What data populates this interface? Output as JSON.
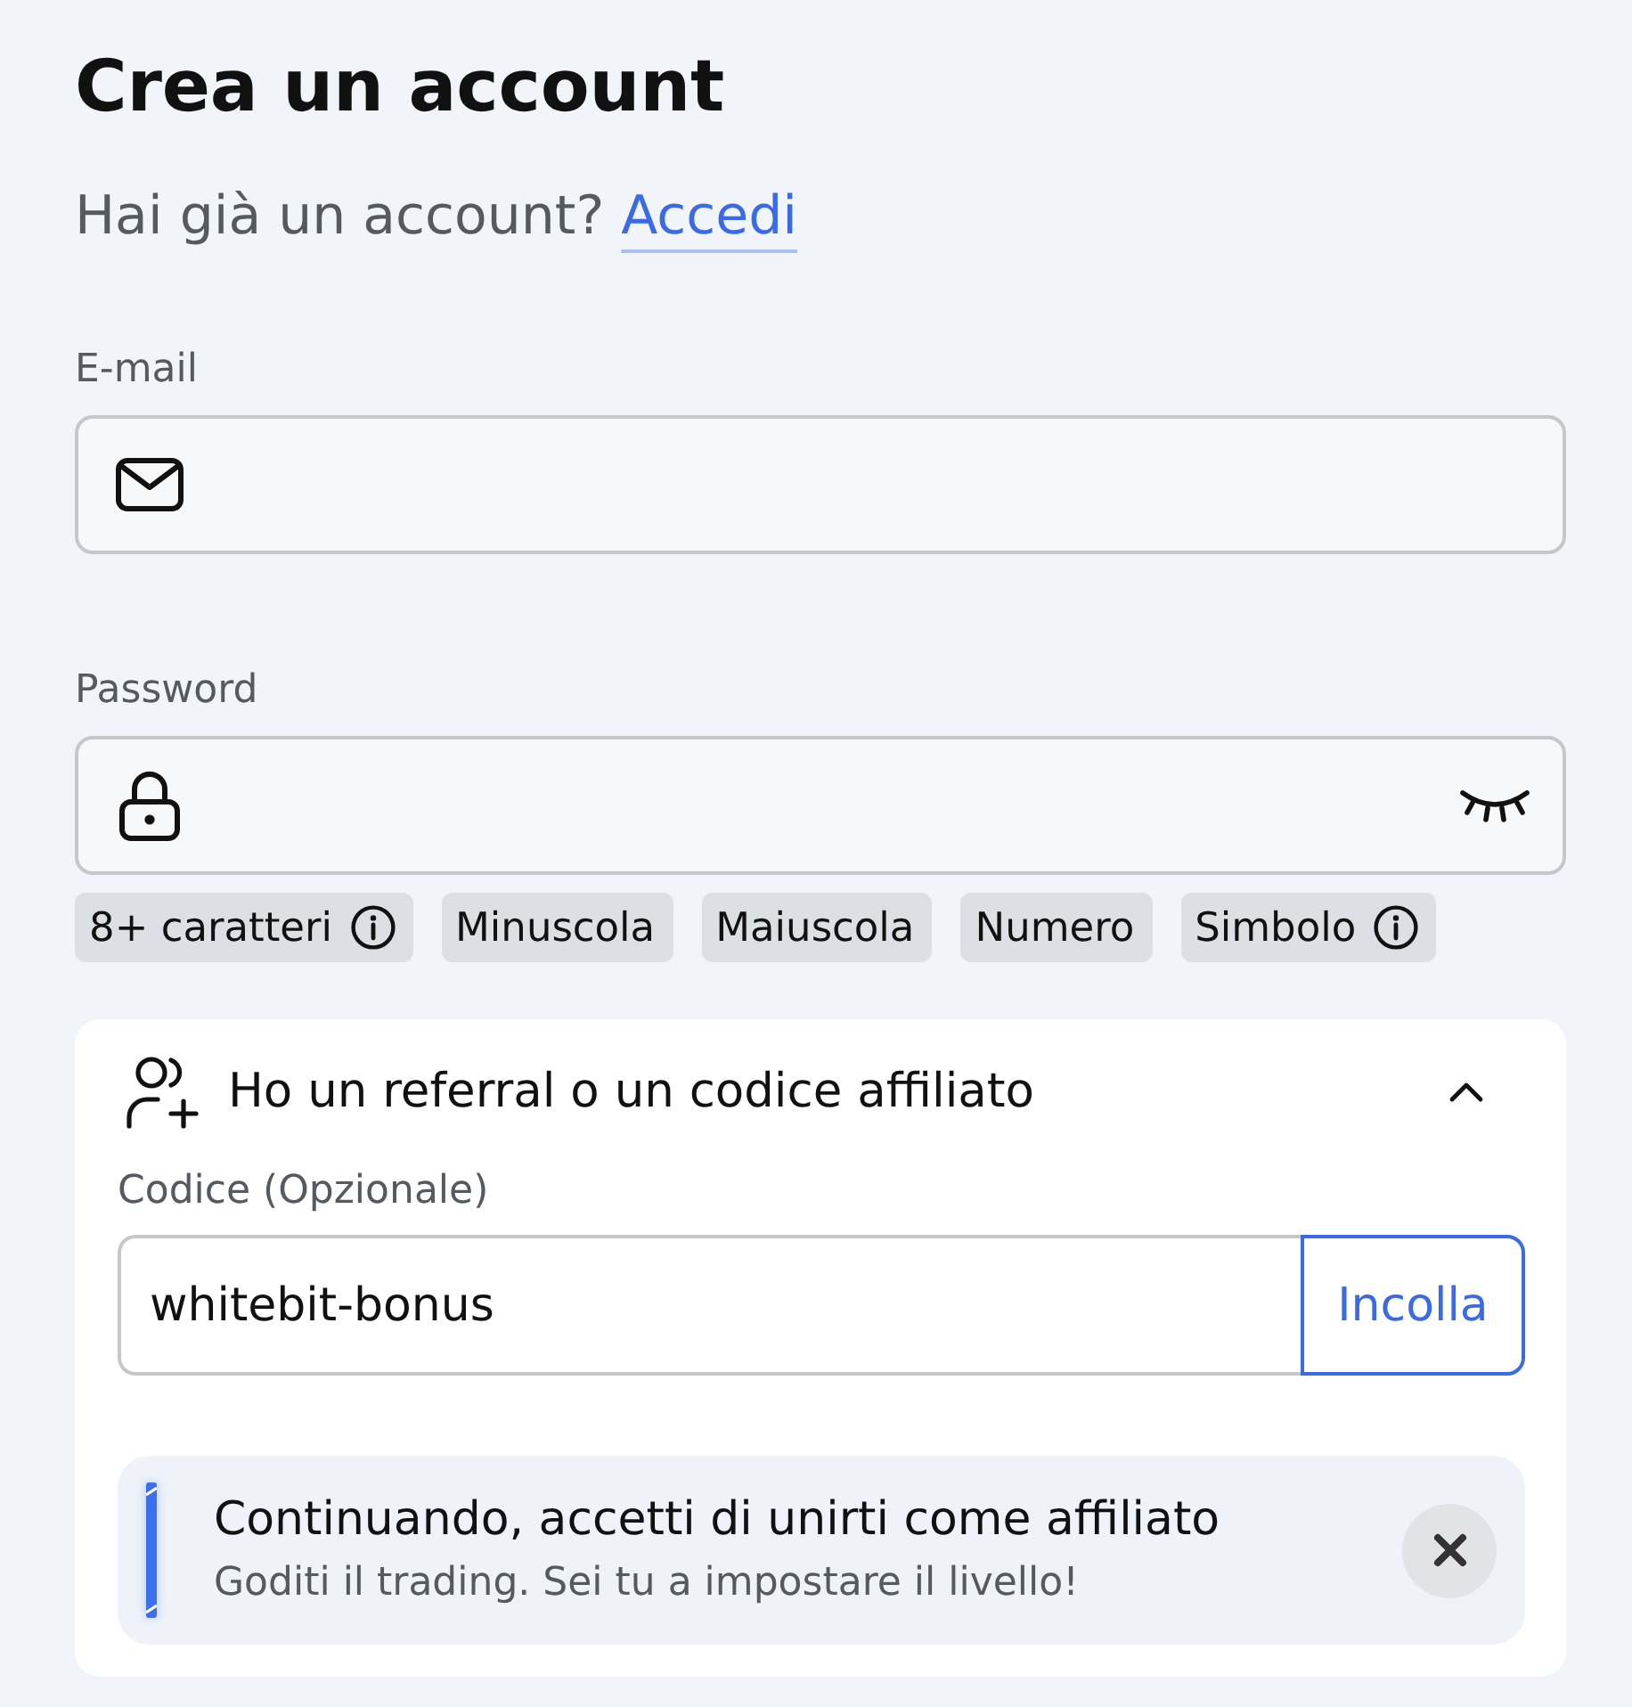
{
  "title": "Crea un account",
  "signin_prompt": {
    "text": "Hai già un account?",
    "link": "Accedi"
  },
  "fields": [
    {
      "kind": "email",
      "label": "E-mail"
    },
    {
      "kind": "password",
      "label": "Password",
      "revealed": false
    }
  ],
  "requirements": [
    {
      "label": "8+ caratteri",
      "info": true,
      "met": false
    },
    {
      "label": "Minuscola",
      "info": false,
      "met": false
    },
    {
      "label": "Maiuscola",
      "info": false,
      "met": false
    },
    {
      "label": "Numero",
      "info": false,
      "met": false
    },
    {
      "label": "Simbolo",
      "info": true,
      "met": false
    }
  ],
  "referral": {
    "title": "Ho un referral o un codice affiliato",
    "expanded": true,
    "code_label": "Codice (Opzionale)",
    "code_value": "whitebit-bonus",
    "paste_button": "Incolla",
    "notice": {
      "title": "Continuando, accetti di unirti come affiliato",
      "text": "Goditi il trading. Sei tu a impostare il livello!"
    }
  }
}
